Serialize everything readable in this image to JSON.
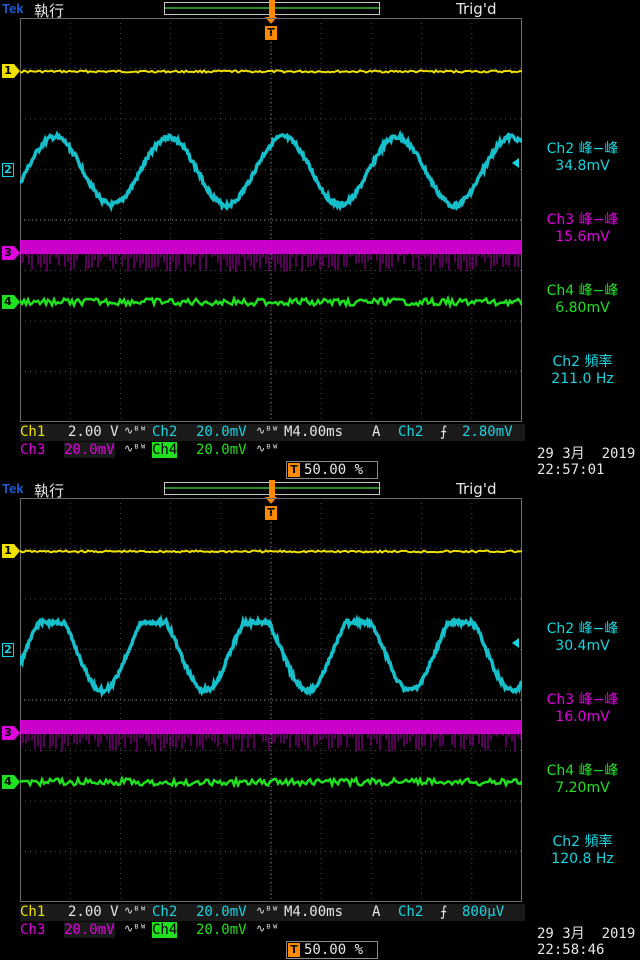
{
  "screens": [
    {
      "brand": "Tek",
      "mode": "執行",
      "trigger_status": "Trig'd",
      "trigger_marker": "T",
      "channel_markers": [
        "1",
        "2",
        "3",
        "4"
      ],
      "colors": {
        "ch1": "#f0e000",
        "ch2": "#19d4e0",
        "ch3": "#e000e0",
        "ch4": "#20e020",
        "trigger": "#ff8a00"
      },
      "measurements": [
        {
          "label": "Ch2 峰−峰",
          "value": "34.8mV",
          "color": "ch2"
        },
        {
          "label": "Ch3 峰−峰",
          "value": "15.6mV",
          "color": "ch3"
        },
        {
          "label": "Ch4 峰−峰",
          "value": "6.80mV",
          "color": "ch4"
        },
        {
          "label": "Ch2 頻率",
          "value": "211.0 Hz",
          "color": "ch2"
        }
      ],
      "readout": {
        "ch1_label": "Ch1",
        "ch1_scale": "2.00 V",
        "ch1_bw": "∿ᴮᵂ",
        "ch2_label": "Ch2",
        "ch2_scale": "20.0mV",
        "ch2_bw": "∿ᴮᵂ",
        "timebase": "M4.00ms",
        "trigger_mode": "A",
        "trigger_source": "Ch2",
        "trigger_slope": "⨍",
        "trigger_level": "2.80mV",
        "ch3_label": "Ch3",
        "ch3_scale": "20.0mV",
        "ch3_bw": "∿ᴮᵂ",
        "ch4_label": "Ch4",
        "ch4_scale": "20.0mV",
        "ch4_bw": "∿ᴮᵂ",
        "position": "50.00 %"
      },
      "date": "29 3月  2019",
      "time": "22:57:01",
      "waveform_ch2": {
        "cycles": 4.4,
        "shape": "sine"
      }
    },
    {
      "brand": "Tek",
      "mode": "執行",
      "trigger_status": "Trig'd",
      "trigger_marker": "T",
      "channel_markers": [
        "1",
        "2",
        "3",
        "4"
      ],
      "colors": {
        "ch1": "#f0e000",
        "ch2": "#19d4e0",
        "ch3": "#e000e0",
        "ch4": "#20e020",
        "trigger": "#ff8a00"
      },
      "measurements": [
        {
          "label": "Ch2 峰−峰",
          "value": "30.4mV",
          "color": "ch2"
        },
        {
          "label": "Ch3 峰−峰",
          "value": "16.0mV",
          "color": "ch3"
        },
        {
          "label": "Ch4 峰−峰",
          "value": "7.20mV",
          "color": "ch4"
        },
        {
          "label": "Ch2 頻率",
          "value": "120.8 Hz",
          "color": "ch2"
        }
      ],
      "readout": {
        "ch1_label": "Ch1",
        "ch1_scale": "2.00 V",
        "ch1_bw": "∿ᴮᵂ",
        "ch2_label": "Ch2",
        "ch2_scale": "20.0mV",
        "ch2_bw": "∿ᴮᵂ",
        "timebase": "M4.00ms",
        "trigger_mode": "A",
        "trigger_source": "Ch2",
        "trigger_slope": "⨍",
        "trigger_level": "800μV",
        "ch3_label": "Ch3",
        "ch3_scale": "20.0mV",
        "ch3_bw": "∿ᴮᵂ",
        "ch4_label": "Ch4",
        "ch4_scale": "20.0mV",
        "ch4_bw": "∿ᴮᵂ",
        "position": "50.00 %"
      },
      "date": "29 3月  2019",
      "time": "22:58:46",
      "waveform_ch2": {
        "cycles": 4.9,
        "shape": "clipped-sine"
      }
    }
  ]
}
